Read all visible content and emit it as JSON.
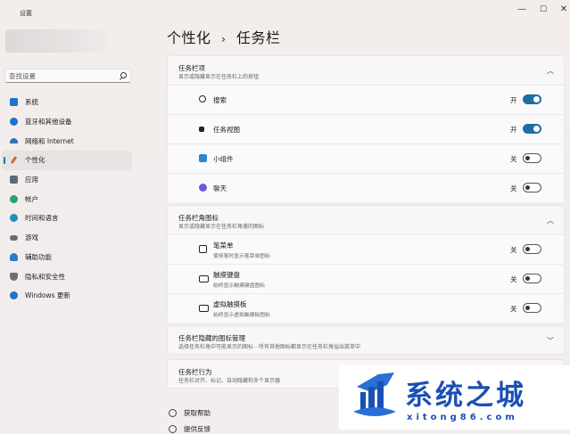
{
  "window": {
    "title": "设置",
    "min_glyph": "—",
    "max_glyph": "☐",
    "close_glyph": "✕"
  },
  "search": {
    "placeholder": "查找设置"
  },
  "sidebar": {
    "items": [
      {
        "label": "系统",
        "icon": "monitor-icon",
        "color": "#1f74c4",
        "active": false
      },
      {
        "label": "蓝牙和其他设备",
        "icon": "bluetooth-icon",
        "color": "#1f6fd0",
        "active": false
      },
      {
        "label": "网络和 Internet",
        "icon": "wifi-icon",
        "color": "#3a6fb5",
        "active": false
      },
      {
        "label": "个性化",
        "icon": "brush-icon",
        "color": "#c86a3a",
        "active": true
      },
      {
        "label": "应用",
        "icon": "apps-icon",
        "color": "#5a6b7a",
        "active": false
      },
      {
        "label": "帐户",
        "icon": "person-icon",
        "color": "#2aa06a",
        "active": false
      },
      {
        "label": "时间和语言",
        "icon": "globe-clock-icon",
        "color": "#2a8ac4",
        "active": false
      },
      {
        "label": "游戏",
        "icon": "controller-icon",
        "color": "#666c74",
        "active": false
      },
      {
        "label": "辅助功能",
        "icon": "accessibility-icon",
        "color": "#2a7bd0",
        "active": false
      },
      {
        "label": "隐私和安全性",
        "icon": "shield-icon",
        "color": "#6b6f77",
        "active": false
      },
      {
        "label": "Windows 更新",
        "icon": "update-icon",
        "color": "#1f74c4",
        "active": false
      }
    ]
  },
  "breadcrumb": {
    "parent": "个性化",
    "sep": "›",
    "current": "任务栏"
  },
  "taskbar_items": {
    "title": "任务栏项",
    "subtitle": "显示或隐藏显示在任务栏上的按钮",
    "rows": [
      {
        "label": "搜索",
        "state": "开",
        "on": true,
        "icon": "search-icon"
      },
      {
        "label": "任务视图",
        "state": "开",
        "on": true,
        "icon": "task-view-icon"
      },
      {
        "label": "小组件",
        "state": "关",
        "on": false,
        "icon": "widgets-icon"
      },
      {
        "label": "聊天",
        "state": "关",
        "on": false,
        "icon": "chat-icon"
      }
    ]
  },
  "corner_icons": {
    "title": "任务栏角图标",
    "subtitle": "显示或隐藏显示在任务栏角落的图标",
    "rows": [
      {
        "label": "笔菜单",
        "sub": "使用笔时显示笔菜单图标",
        "state": "关",
        "on": false,
        "icon": "pen-icon"
      },
      {
        "label": "触摸键盘",
        "sub": "始终显示触摸键盘图标",
        "state": "关",
        "on": false,
        "icon": "keyboard-icon"
      },
      {
        "label": "虚拟触摸板",
        "sub": "始终显示虚拟触摸板图标",
        "state": "关",
        "on": false,
        "icon": "touchpad-icon"
      }
    ]
  },
  "overflow": {
    "title": "任务栏隐藏的图标管理",
    "subtitle": "选择任务栏角中可能显示的图标 - 所有其他图标都显示在任务栏角溢出菜单中"
  },
  "behaviors": {
    "title": "任务栏行为",
    "subtitle": "任务栏对齐、标记、自动隐藏和多个显示器"
  },
  "footer": {
    "help": "获取帮助",
    "feedback": "提供反馈"
  },
  "watermark": {
    "name": "系统之城",
    "url": "xitong86.com"
  }
}
